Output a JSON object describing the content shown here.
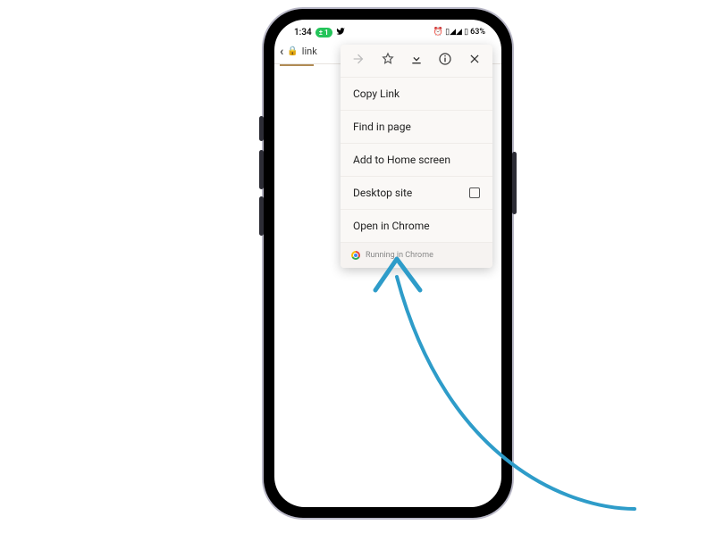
{
  "status": {
    "time": "1:34",
    "battery_text": "63%",
    "pill_text": "1",
    "right_icons_text": "⏰ ▯◢◢ ▯"
  },
  "url_bar": {
    "text": "link"
  },
  "menu": {
    "items": {
      "copy_link": "Copy Link",
      "find_in_page": "Find in page",
      "add_home": "Add to Home screen",
      "desktop_site": "Desktop site",
      "open_chrome": "Open in Chrome"
    },
    "footer": "Running in Chrome"
  },
  "colors": {
    "arrow": "#2e9cc9"
  }
}
